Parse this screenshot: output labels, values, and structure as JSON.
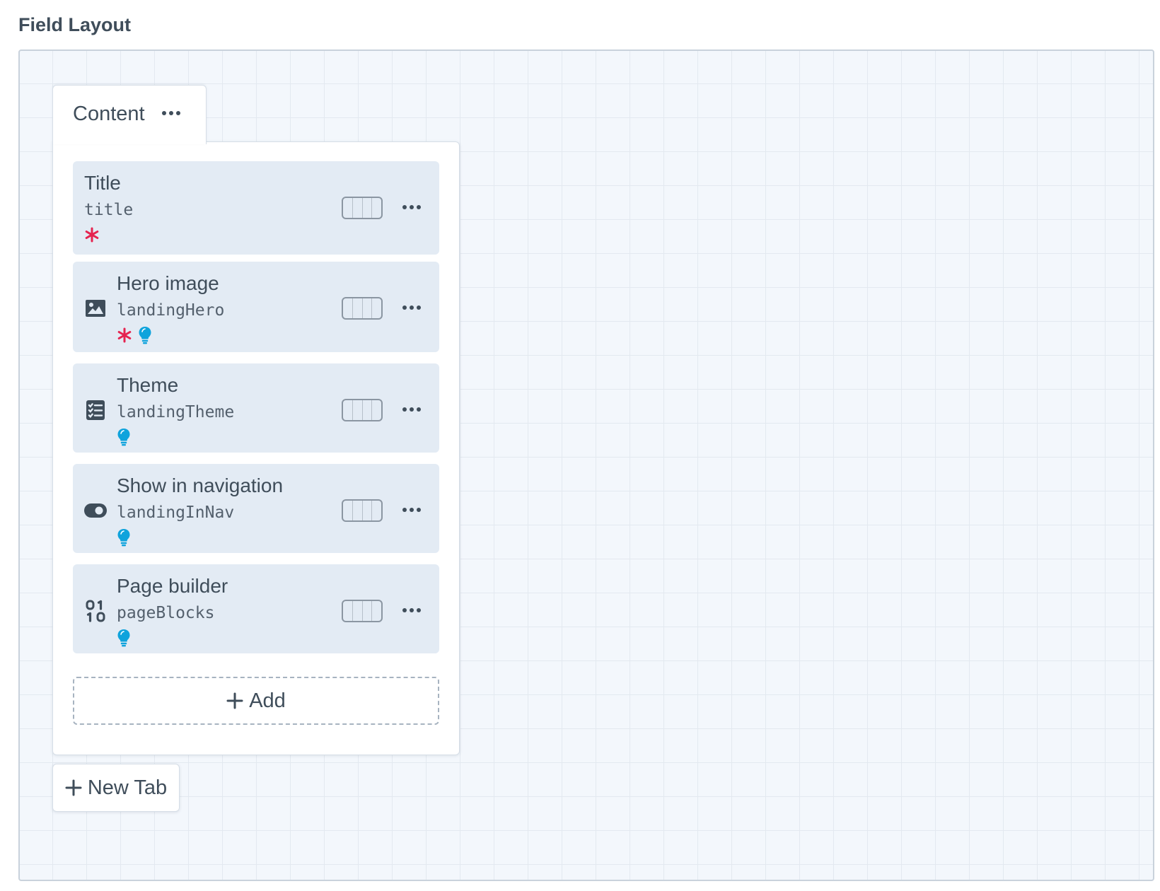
{
  "heading": "Field Layout",
  "tab": {
    "label": "Content"
  },
  "fields": [
    {
      "name": "Title",
      "handle": "title",
      "icon": "text-icon",
      "required": true,
      "tip": false
    },
    {
      "name": "Hero image",
      "handle": "landingHero",
      "icon": "image-icon",
      "required": true,
      "tip": true
    },
    {
      "name": "Theme",
      "handle": "landingTheme",
      "icon": "list-icon",
      "required": false,
      "tip": true
    },
    {
      "name": "Show in navigation",
      "handle": "landingInNav",
      "icon": "toggle-icon",
      "required": false,
      "tip": true
    },
    {
      "name": "Page builder",
      "handle": "pageBlocks",
      "icon": "binary-icon",
      "required": false,
      "tip": true
    }
  ],
  "add_label": "Add",
  "new_tab_label": "New Tab",
  "colors": {
    "required": "#e5234f",
    "tip": "#0fa3dc",
    "card": "#e3ebf4",
    "canvas": "#f3f7fc"
  }
}
